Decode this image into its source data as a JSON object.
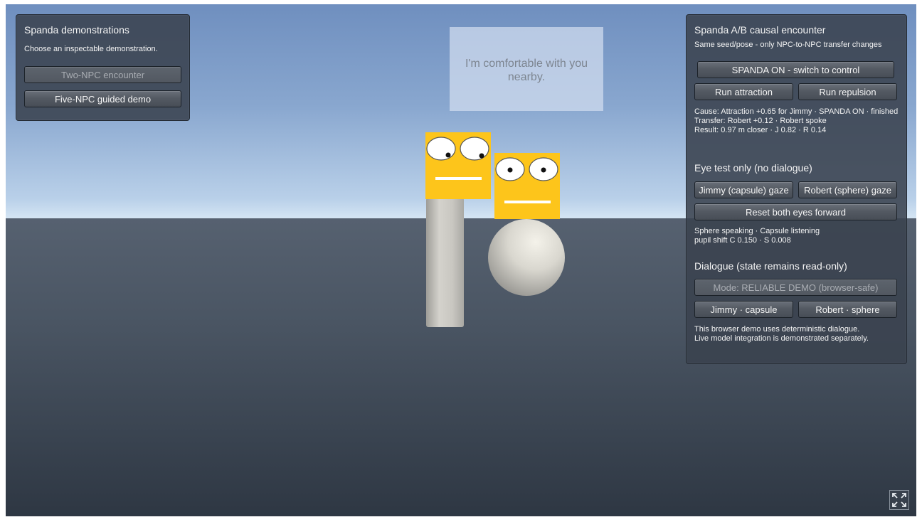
{
  "left_panel": {
    "title": "Spanda demonstrations",
    "subtitle": "Choose an inspectable demonstration.",
    "buttons": {
      "two_npc": "Two-NPC encounter",
      "five_npc": "Five-NPC guided demo"
    }
  },
  "speech_bubble": {
    "text": "I'm comfortable with you nearby."
  },
  "right_panel": {
    "ab": {
      "title": "Spanda A/B causal encounter",
      "subtitle": "Same seed/pose - only NPC-to-NPC transfer changes",
      "toggle_button": "SPANDA ON - switch to control",
      "attraction_button": "Run attraction",
      "repulsion_button": "Run repulsion",
      "status": [
        "Cause: Attraction +0.65 for Jimmy · SPANDA ON · finished",
        "Transfer: Robert +0.12 · Robert spoke",
        "Result: 0.97 m closer · J 0.82 · R 0.14"
      ]
    },
    "eye_test": {
      "title": "Eye test only (no dialogue)",
      "jimmy_gaze_button": "Jimmy (capsule) gaze",
      "robert_gaze_button": "Robert (sphere) gaze",
      "reset_button": "Reset both eyes forward",
      "status": [
        "Sphere speaking · Capsule listening",
        "pupil shift C 0.150 · S 0.008"
      ]
    },
    "dialogue": {
      "title": "Dialogue (state remains read-only)",
      "mode_button": "Mode: RELIABLE DEMO (browser-safe)",
      "jimmy_button": "Jimmy · capsule",
      "robert_button": "Robert · sphere",
      "note": [
        "This browser demo uses deterministic dialogue.",
        "Live model integration is demonstrated separately."
      ]
    }
  },
  "colors": {
    "face": "#fdc51b",
    "panel": "#3a424e",
    "capsule": "#c8c6c0",
    "sphere": "#e2e0d8"
  },
  "icons": {
    "fullscreen": "fullscreen-expand-icon"
  }
}
